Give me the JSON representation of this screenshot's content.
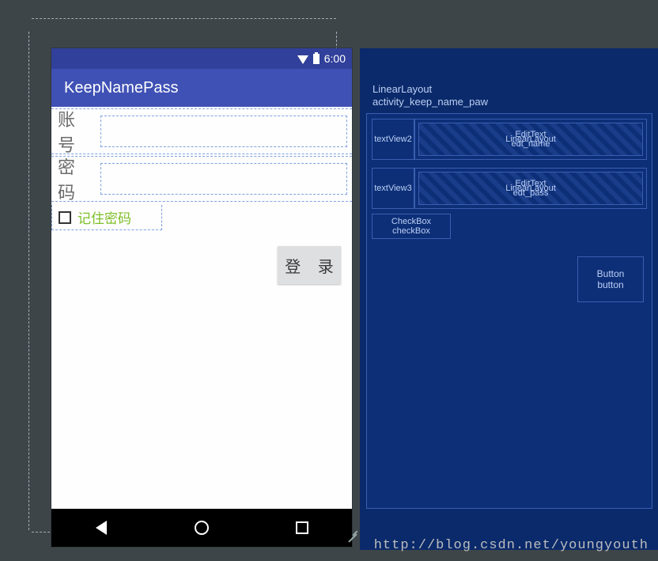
{
  "statusbar": {
    "time": "6:00"
  },
  "appbar": {
    "title": "KeepNamePass"
  },
  "form": {
    "username_label": "账 号",
    "password_label": "密 码",
    "username_value": "",
    "password_value": "",
    "remember_label": "记住密码",
    "login_label": "登 录"
  },
  "blueprint": {
    "root_type": "LinearLayout",
    "root_id": "activity_keep_name_paw",
    "row1_tv": "textView2",
    "row1_ll": "LinearLayout",
    "row1_edit_type": "EditText",
    "row1_edit_id": "edt_name",
    "row2_tv": "textView3",
    "row2_ll": "LinearLayout",
    "row2_edit_type": "EditText",
    "row2_edit_id": "edt_pass",
    "check_type": "CheckBox",
    "check_id": "checkBox",
    "btn_type": "Button",
    "btn_id": "button"
  },
  "watermark": "http://blog.csdn.net/youngyouth"
}
